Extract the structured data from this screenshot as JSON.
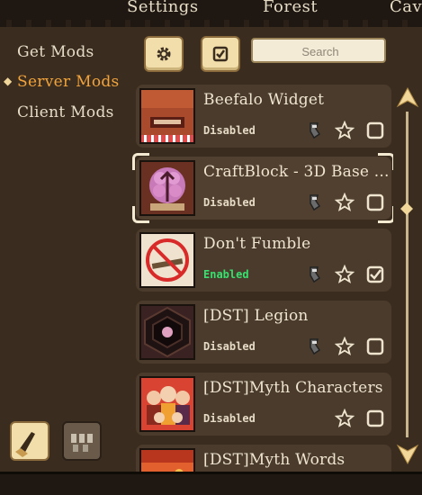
{
  "tabs": {
    "settings": "Settings",
    "forest": "Forest",
    "caves": "Cav"
  },
  "nav": {
    "get_mods": "Get Mods",
    "server_mods": "Server Mods",
    "client_mods": "Client Mods"
  },
  "search": {
    "placeholder": "Search"
  },
  "mods": [
    {
      "title": "Beefalo Widget",
      "status": "Disabled"
    },
    {
      "title": "CraftBlock - 3D Base ...",
      "status": "Disabled"
    },
    {
      "title": "Don't Fumble",
      "status": "Enabled"
    },
    {
      "title": "[DST] Legion",
      "status": "Disabled"
    },
    {
      "title": "[DST]Myth Characters",
      "status": "Disabled"
    },
    {
      "title": "[DST]Myth Words",
      "status": ""
    }
  ],
  "colors": {
    "accent": "#f2a33b",
    "enabled": "#38e06f",
    "panel": "#4a3b2c"
  },
  "icons": [
    "gear-icon",
    "checkbox-icon",
    "wrench-icon",
    "star-icon",
    "toggle-icon",
    "scroll-up-arrow-icon",
    "scroll-down-arrow-icon",
    "broom-icon",
    "cleanup-icon"
  ]
}
